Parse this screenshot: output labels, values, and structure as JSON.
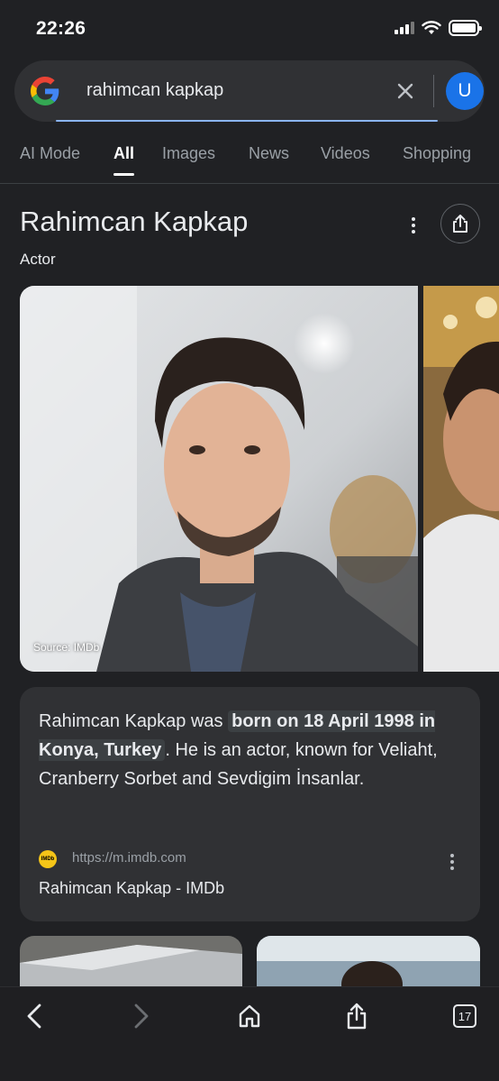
{
  "status_bar": {
    "time": "22:26"
  },
  "search": {
    "query": "rahimcan kapkap",
    "avatar_letter": "U"
  },
  "tabs": [
    {
      "label": "AI Mode",
      "active": false
    },
    {
      "label": "All",
      "active": true
    },
    {
      "label": "Images",
      "active": false
    },
    {
      "label": "News",
      "active": false
    },
    {
      "label": "Videos",
      "active": false
    },
    {
      "label": "Shopping",
      "active": false
    }
  ],
  "knowledge_panel": {
    "title": "Rahimcan Kapkap",
    "subtitle": "Actor",
    "photo_source": "Source: IMDb"
  },
  "description": {
    "part1": "Rahimcan Kapkap was ",
    "highlight": "born on 18 April 1998 in Konya, Turkey",
    "part2": ". He is an actor, known for Veliaht, Cranberry Sorbet and Sevdigim İnsanlar.",
    "source_favicon_text": "IMDb",
    "source_url": "https://m.imdb.com",
    "source_title": "Rahimcan Kapkap - IMDb"
  },
  "toolbar": {
    "tab_count": "17"
  },
  "colors": {
    "background": "#202124",
    "card": "#303134",
    "accent": "#8ab4f8",
    "avatar": "#1a73e8",
    "imdb": "#f5c518"
  },
  "icons": [
    "google-logo-icon",
    "clear-icon",
    "more-vert-icon",
    "share-icon",
    "back-icon",
    "forward-icon",
    "home-icon",
    "share-toolbar-icon",
    "tabs-icon"
  ]
}
